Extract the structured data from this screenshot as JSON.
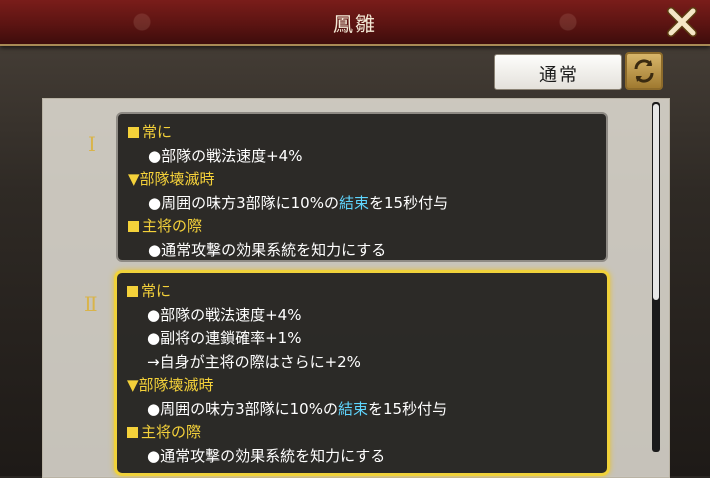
{
  "title": "鳳雛",
  "mode": {
    "label": "通常"
  },
  "effects": [
    {
      "roman": "Ⅰ",
      "lines": [
        {
          "kind": "header",
          "marker": "square",
          "text": "常に"
        },
        {
          "kind": "item",
          "text": "●部隊の戦法速度+4%"
        },
        {
          "kind": "header",
          "marker": "triangle",
          "text": "▼部隊壊滅時"
        },
        {
          "kind": "item",
          "pre": "●周囲の味方3部隊に10%の",
          "hl": "結束",
          "post": "を15秒付与"
        },
        {
          "kind": "header",
          "marker": "square",
          "text": "主将の際"
        },
        {
          "kind": "item",
          "text": "●通常攻撃の効果系統を知力にする"
        }
      ]
    },
    {
      "roman": "Ⅱ",
      "lines": [
        {
          "kind": "header",
          "marker": "square",
          "text": "常に"
        },
        {
          "kind": "item",
          "text": "●部隊の戦法速度+4%"
        },
        {
          "kind": "item",
          "text": "●副将の連鎖確率+1%"
        },
        {
          "kind": "item",
          "text": "→自身が主将の際はさらに+2%"
        },
        {
          "kind": "header",
          "marker": "triangle",
          "text": "▼部隊壊滅時"
        },
        {
          "kind": "item",
          "pre": "●周囲の味方3部隊に10%の",
          "hl": "結束",
          "post": "を15秒付与"
        },
        {
          "kind": "header",
          "marker": "square",
          "text": "主将の際"
        },
        {
          "kind": "item",
          "text": "●通常攻撃の効果系統を知力にする"
        }
      ]
    }
  ],
  "colors": {
    "header": "#f4d13a",
    "highlight": "#5fd6ff",
    "selected_border": "#f0d23a"
  }
}
